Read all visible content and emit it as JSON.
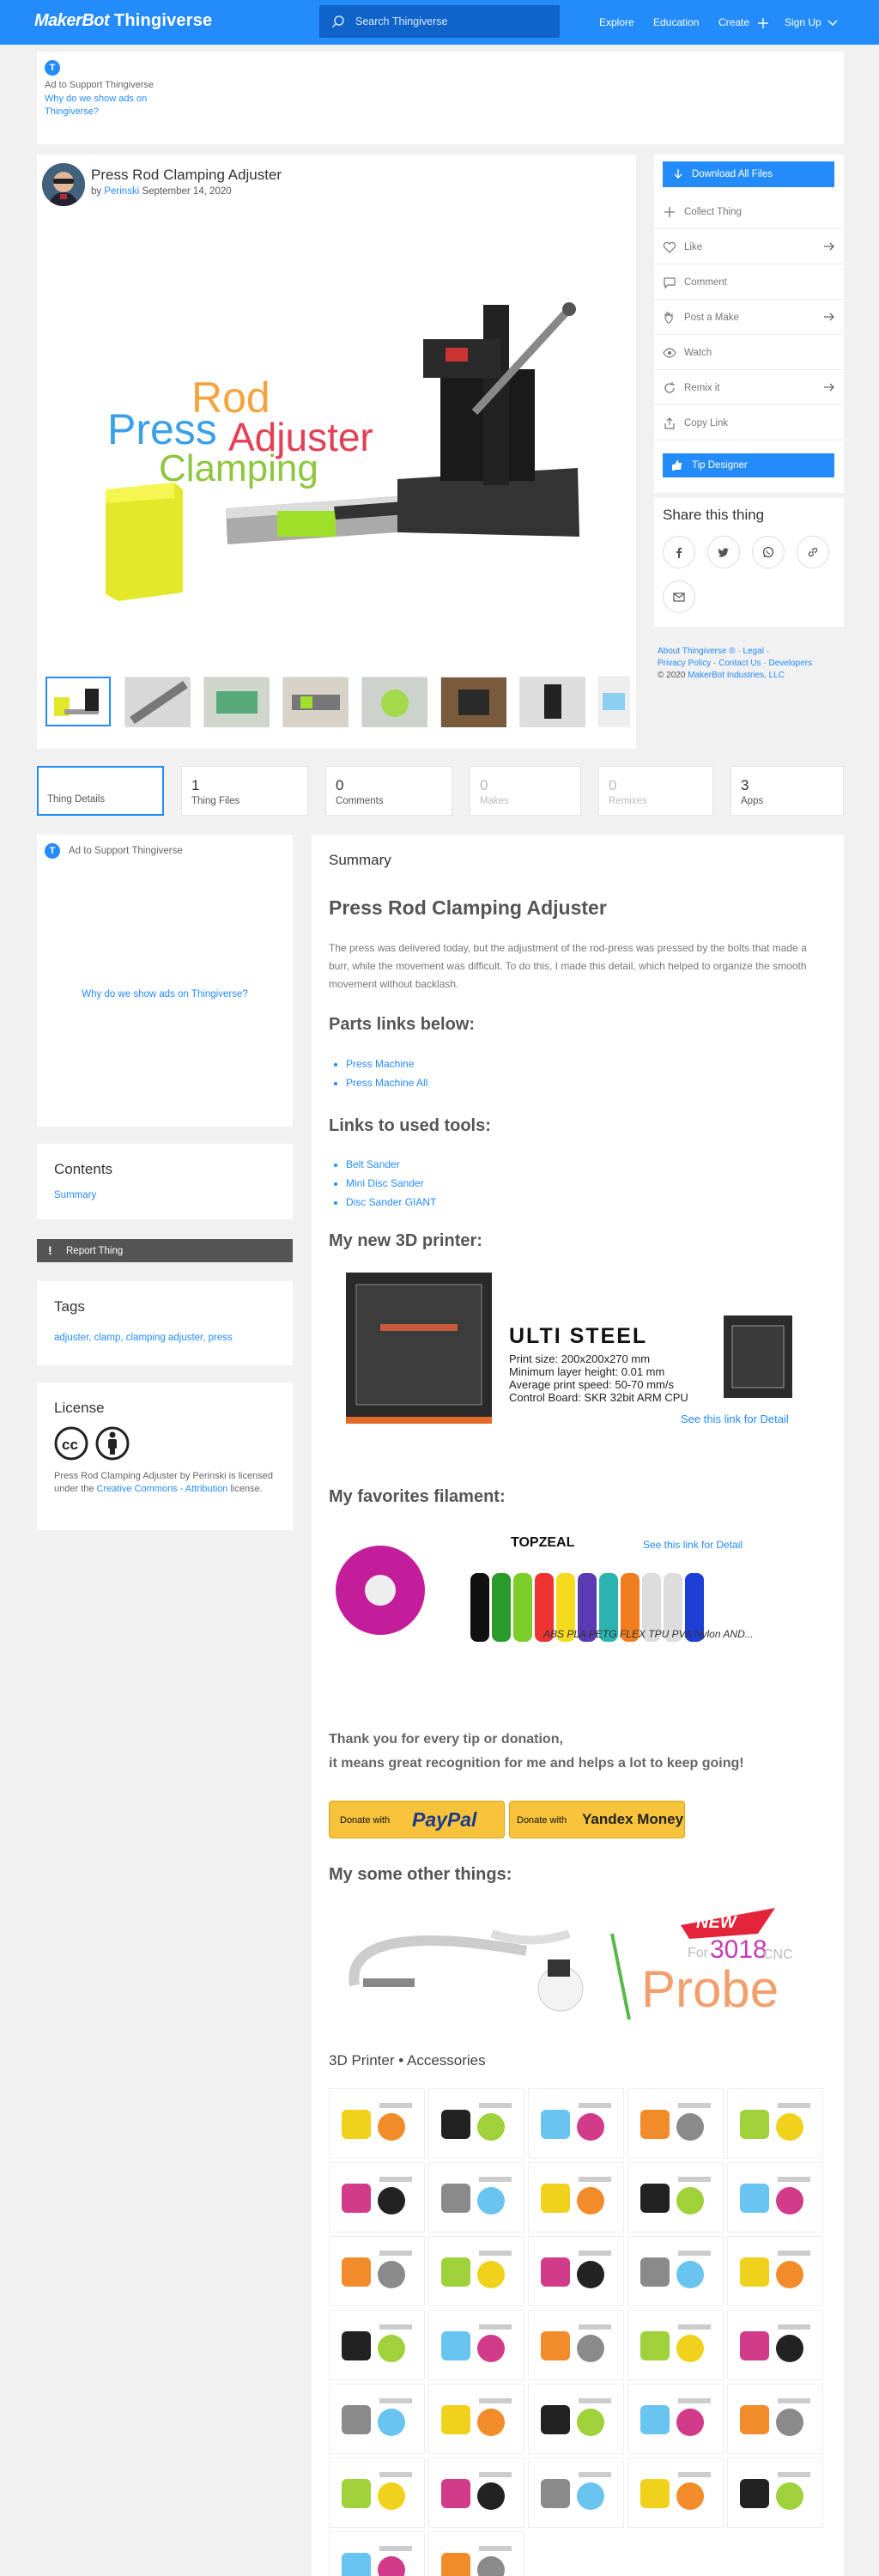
{
  "header": {
    "logo_makerbot": "MakerBot",
    "logo_thingiverse": "Thingiverse",
    "search_placeholder": "Search Thingiverse",
    "nav": [
      "Explore",
      "Education",
      "Create",
      "Sign Up"
    ]
  },
  "ad_top": {
    "badge": "T",
    "label": "Ad to Support Thingiverse",
    "why_link": "Why do we show ads on Thingiverse?"
  },
  "thing": {
    "title": "Press Rod Clamping Adjuster",
    "by_prefix": "by",
    "author": "Perinski",
    "date": "September 14, 2020",
    "hero_words": [
      "Rod",
      "Press",
      "Adjuster",
      "Clamping"
    ],
    "thumb_count": 8
  },
  "actions": {
    "download": "Download All Files",
    "items": [
      "Collect Thing",
      "Like",
      "Comment",
      "Post a Make",
      "Watch",
      "Remix it",
      "Copy Link"
    ],
    "tip": "Tip Designer"
  },
  "share": {
    "heading": "Share this thing",
    "icons": [
      "facebook-icon",
      "twitter-icon",
      "whatsapp-icon",
      "link-icon",
      "email-icon"
    ]
  },
  "footer_links": {
    "about": "About Thingiverse ®",
    "legal": "Legal",
    "privacy": "Privacy Policy",
    "contact": "Contact Us",
    "developers": "Developers",
    "copyright_prefix": "© 2020",
    "company": "MakerBot Industries, LLC"
  },
  "tabs": [
    {
      "num": "",
      "label": "Thing Details"
    },
    {
      "num": "1",
      "label": "Thing Files"
    },
    {
      "num": "0",
      "label": "Comments"
    },
    {
      "num": "0",
      "label": "Makes"
    },
    {
      "num": "0",
      "label": "Remixes"
    },
    {
      "num": "3",
      "label": "Apps"
    }
  ],
  "ad_left": {
    "label": "Ad to Support Thingiverse",
    "why_link": "Why do we show ads on Thingiverse?"
  },
  "contents": {
    "heading": "Contents",
    "link": "Summary"
  },
  "report": "Report Thing",
  "tags": {
    "heading": "Tags",
    "items": [
      "adjuster",
      "clamp",
      "clamping adjuster",
      "press"
    ]
  },
  "license": {
    "heading": "License",
    "text_pre": "Press Rod Clamping Adjuster by Perinski is licensed under the",
    "link": "Creative Commons - Attribution",
    "text_post": "license."
  },
  "summary": {
    "heading": "Summary",
    "title": "Press Rod Clamping Adjuster",
    "paragraph": "The press was delivered today, but the adjustment of the rod-press was pressed by the bolts that made a burr, while the movement was difficult. To do this, I made this detail, which helped to organize the smooth movement without backlash.",
    "parts_heading": "Parts links below:",
    "parts": [
      "Press Machine",
      "Press Machine All"
    ],
    "tools_heading": "Links to used tools:",
    "tools": [
      "Belt Sander",
      "Mini Disc Sander",
      "Disc Sander GIANT"
    ],
    "printer_heading": "My new 3D printer:",
    "printer": {
      "name": "ULTI STEEL",
      "specs": [
        "Print size: 200x200x270 mm",
        "Minimum layer height: 0.01 mm",
        "Average print speed: 50-70 mm/s",
        "Control Board: SKR 32bit ARM CPU"
      ],
      "link": "See this link for Detail"
    },
    "filament_heading": "My favorites filament:",
    "filament": {
      "brand": "TOPZEAL",
      "link": "See this link for Detail",
      "types": "ABS PLA PETG FLEX TPU PVA Nylon AND..."
    },
    "thanks": [
      "Thank you for every tip or donation,",
      "it means great recognition for me and helps a lot to keep going!"
    ],
    "donate": [
      {
        "prefix": "Donate with",
        "brand": "PayPal"
      },
      {
        "prefix": "Donate with",
        "brand": "Yandex Money"
      }
    ],
    "other_heading": "My some other things:",
    "probe": {
      "new": "NEW",
      "text": "Probe",
      "for": "For",
      "model": "3018",
      "cnc": "CNC"
    },
    "accessories_heading": "3D Printer • Accessories"
  },
  "colors": {
    "brand_blue": "#248bfb",
    "search_blue": "#0f63c9",
    "donate_yellow": "#f7c33b"
  }
}
